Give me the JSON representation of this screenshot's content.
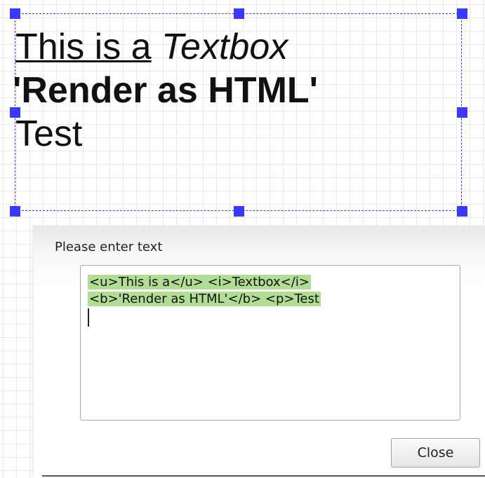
{
  "canvas": {
    "textbox": {
      "line1_underlined": "This is a",
      "line1_italic": "Textbox",
      "line2_bold": "'Render as HTML'",
      "line3": "Test"
    }
  },
  "dialog": {
    "label": "Please enter text",
    "textarea": {
      "line1": "<u>This is a</u> <i>Textbox</i>",
      "line2": "<b>'Render as HTML'</b> <p>Test"
    },
    "close_label": "Close"
  },
  "colors": {
    "selection_border": "#3a3af0",
    "handle": "#3a3aff",
    "text_selection_highlight": "#b2dd94"
  }
}
